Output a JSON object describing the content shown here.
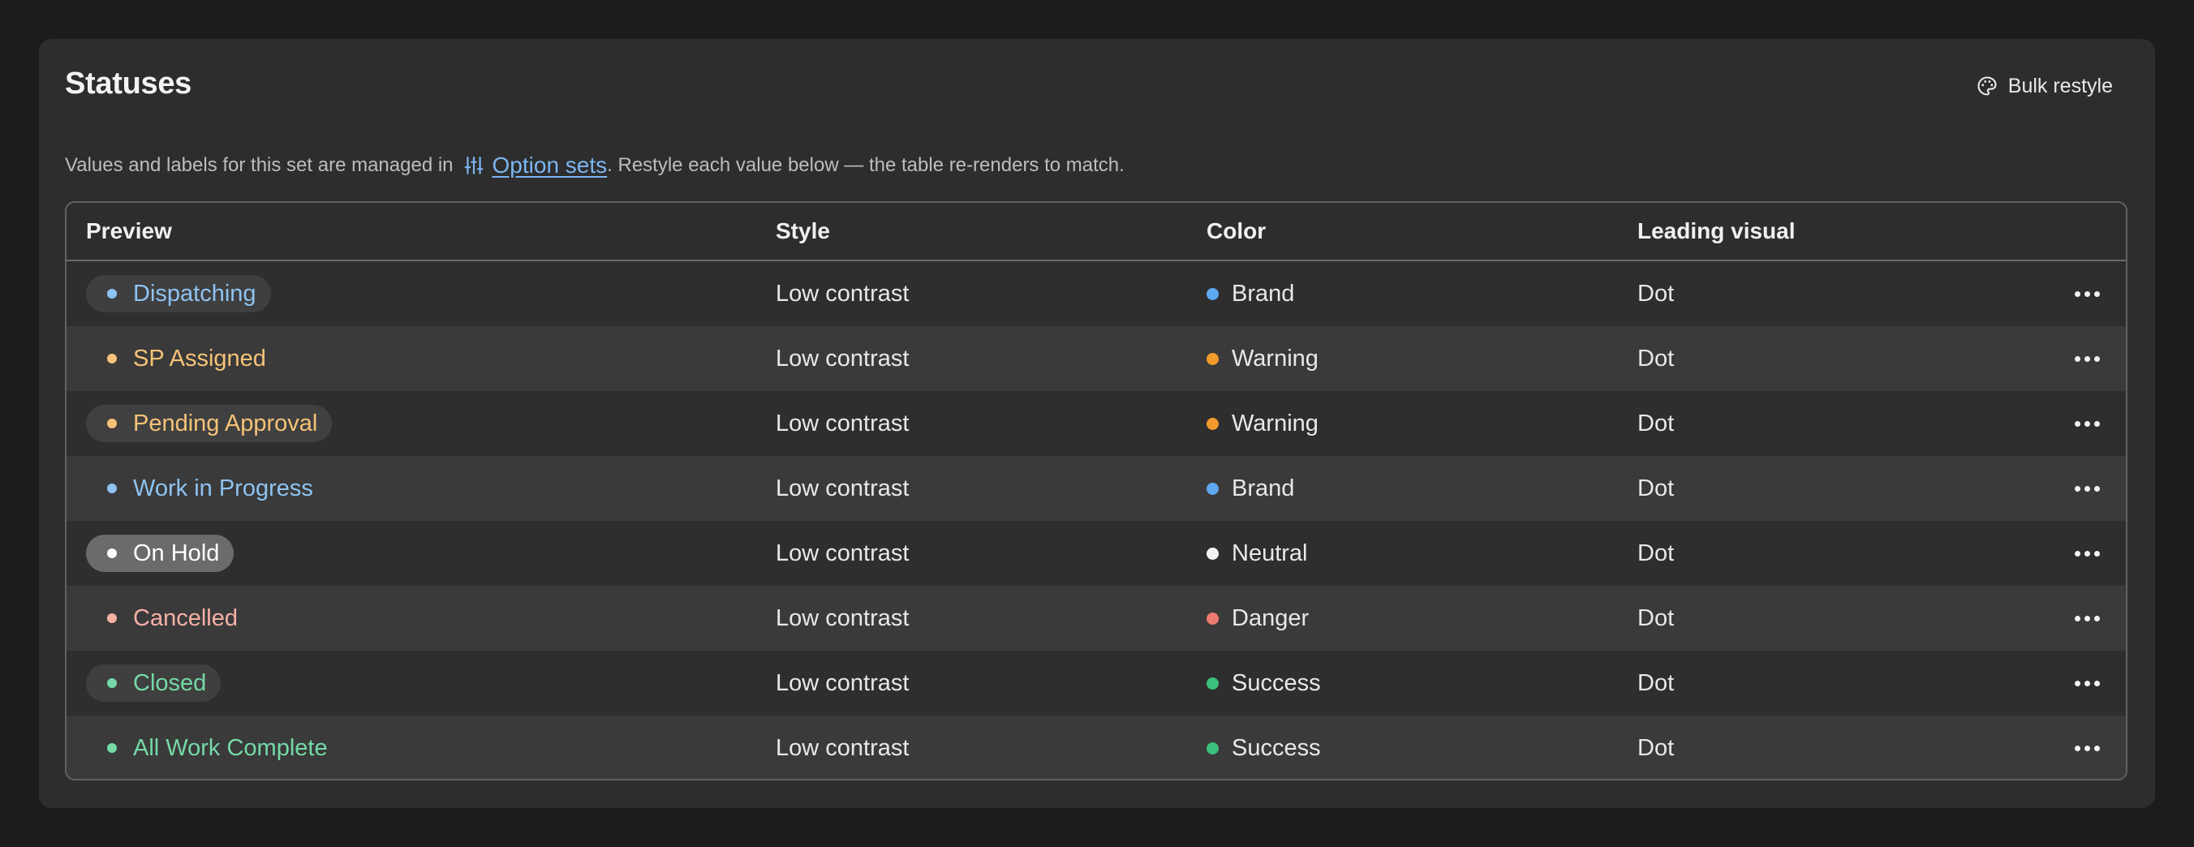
{
  "section": {
    "title": "Statuses",
    "bulk_restyle_label": "Bulk restyle",
    "desc_before": "Values and labels for this set are managed in",
    "desc_link": "Option sets",
    "desc_after": ". Restyle each value below — the table re-renders to match."
  },
  "table": {
    "headers": {
      "preview": "Preview",
      "style": "Style",
      "color": "Color",
      "leading_visual": "Leading visual"
    },
    "rows": [
      {
        "label": "Dispatching",
        "style": "Low contrast",
        "color": "Brand",
        "visual": "Dot",
        "text_color": "#8ec3f2",
        "dot_color": "#8ec3f2",
        "pill_bg": "#3f3f3f",
        "swatch": "#5ea8ef"
      },
      {
        "label": "SP Assigned",
        "style": "Low contrast",
        "color": "Warning",
        "visual": "Dot",
        "text_color": "#f6c377",
        "dot_color": "#f6c377",
        "pill_bg": "transparent",
        "swatch": "#f39a2d"
      },
      {
        "label": "Pending Approval",
        "style": "Low contrast",
        "color": "Warning",
        "visual": "Dot",
        "text_color": "#f6c377",
        "dot_color": "#f6c377",
        "pill_bg": "#404040",
        "swatch": "#f39a2d"
      },
      {
        "label": "Work in Progress",
        "style": "Low contrast",
        "color": "Brand",
        "visual": "Dot",
        "text_color": "#8ec3f2",
        "dot_color": "#8ec3f2",
        "pill_bg": "transparent",
        "swatch": "#5ea8ef"
      },
      {
        "label": "On Hold",
        "style": "Low contrast",
        "color": "Neutral",
        "visual": "Dot",
        "text_color": "#ffffff",
        "dot_color": "#ffffff",
        "pill_bg": "#6b6b6b",
        "swatch": "#f2f2f2"
      },
      {
        "label": "Cancelled",
        "style": "Low contrast",
        "color": "Danger",
        "visual": "Dot",
        "text_color": "#f7b1a5",
        "dot_color": "#f7b1a5",
        "pill_bg": "transparent",
        "swatch": "#ee7b6f"
      },
      {
        "label": "Closed",
        "style": "Low contrast",
        "color": "Success",
        "visual": "Dot",
        "text_color": "#74d9a6",
        "dot_color": "#74d9a6",
        "pill_bg": "#3f3f3f",
        "swatch": "#3cbf7c"
      },
      {
        "label": "All Work Complete",
        "style": "Low contrast",
        "color": "Success",
        "visual": "Dot",
        "text_color": "#74d9a6",
        "dot_color": "#74d9a6",
        "pill_bg": "transparent",
        "swatch": "#3cbf7c"
      }
    ]
  },
  "icons": {
    "bulk_restyle": "palette-icon",
    "option_sets": "sliders-icon",
    "row_menu": "more-horizontal-icon"
  }
}
